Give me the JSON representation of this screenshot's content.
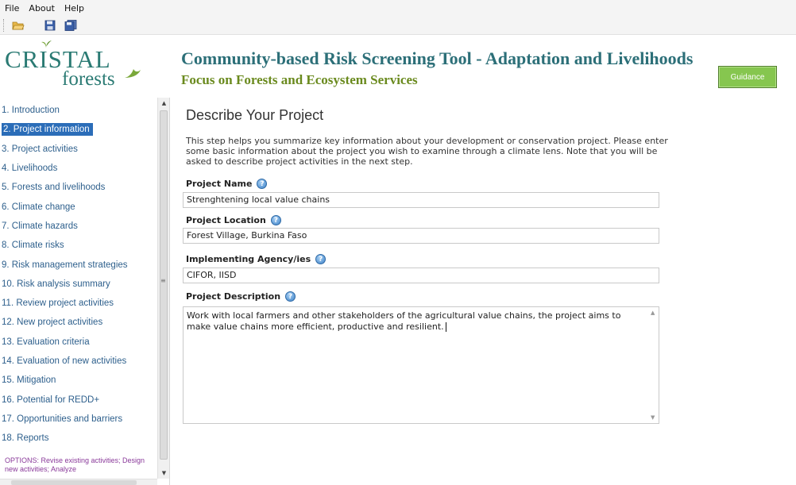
{
  "menu": {
    "file": "File",
    "about": "About",
    "help": "Help"
  },
  "toolbar": {
    "open_icon": "folder-open-icon",
    "save_icon": "save-icon",
    "save_all_icon": "save-all-icon"
  },
  "logo": {
    "line1": "CRISTAL",
    "line2": "forests"
  },
  "header": {
    "title": "Community-based Risk Screening Tool - Adaptation and Livelihoods",
    "subtitle": "Focus on Forests and Ecosystem Services",
    "guidance_label": "Guidance"
  },
  "sidebar": {
    "items": [
      {
        "label": "1. Introduction"
      },
      {
        "label": "2. Project information",
        "active": true
      },
      {
        "label": "3. Project activities"
      },
      {
        "label": "4. Livelihoods"
      },
      {
        "label": "5. Forests and livelihoods"
      },
      {
        "label": "6. Climate change"
      },
      {
        "label": "7. Climate hazards"
      },
      {
        "label": "8. Climate risks"
      },
      {
        "label": "9. Risk management strategies"
      },
      {
        "label": "10. Risk analysis summary"
      },
      {
        "label": "11. Review project activities"
      },
      {
        "label": "12. New project activities"
      },
      {
        "label": "13. Evaluation criteria"
      },
      {
        "label": "14. Evaluation of new activities"
      },
      {
        "label": "15. Mitigation"
      },
      {
        "label": "16. Potential for REDD+"
      },
      {
        "label": "17. Opportunities and barriers"
      },
      {
        "label": "18. Reports"
      }
    ],
    "options_text": "OPTIONS: Revise existing activities; Design new activities; Analyze"
  },
  "main": {
    "title": "Describe Your Project",
    "intro": "This step helps you summarize key information about your development or conservation project. Please enter some basic information about the project you wish to examine through a climate lens. Note that you will be asked to describe project activities in the next step.",
    "fields": {
      "name": {
        "label": "Project Name",
        "value": "Strenghtening local value chains"
      },
      "location": {
        "label": "Project Location",
        "value": "Forest Village, Burkina Faso"
      },
      "agency": {
        "label": "Implementing Agency/ies",
        "value": "CIFOR, IISD"
      },
      "description": {
        "label": "Project Description",
        "value": "Work with local farmers and other stakeholders of the agricultural value chains, the project aims to make value chains more efficient, productive and resilient."
      }
    }
  },
  "colors": {
    "nav_link": "#2d5f8c",
    "nav_active_bg": "#2b6db8",
    "title_teal": "#2c6f78",
    "subtitle_green": "#6a8a1e",
    "guidance_green": "#86c64f",
    "options_purple": "#8a3a9a"
  }
}
